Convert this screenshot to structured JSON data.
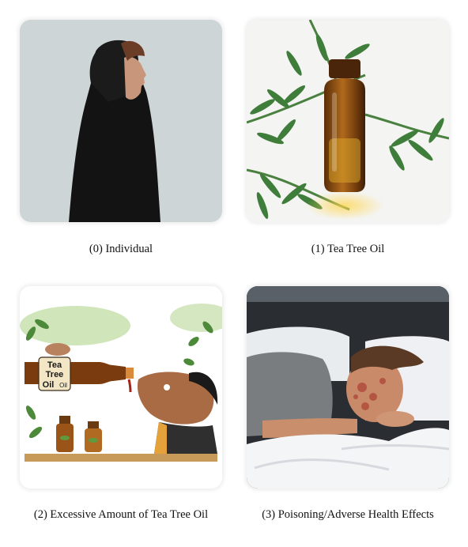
{
  "panels": [
    {
      "caption": "(0) Individual",
      "image": "hooded-person-profile"
    },
    {
      "caption": "(1) Tea Tree Oil",
      "image": "tea-tree-oil-bottle"
    },
    {
      "caption": "(2) Excessive Amount of Tea Tree Oil",
      "image": "person-drinking-oil-cartoon",
      "bottle_label_line1": "Tea",
      "bottle_label_line2": "Tree",
      "bottle_label_line3": "Oil",
      "bottle_label_line4": "Oil"
    },
    {
      "caption": "(3) Poisoning/Adverse Health Effects",
      "image": "sick-person-in-bed"
    }
  ],
  "colors": {
    "panel0_bg": "#cfd6d8",
    "oil_amber": "#8a4a10",
    "leaf_green": "#3f7d3a",
    "bed_white": "#eef0f3",
    "shirt_gray": "#7a7d80"
  }
}
